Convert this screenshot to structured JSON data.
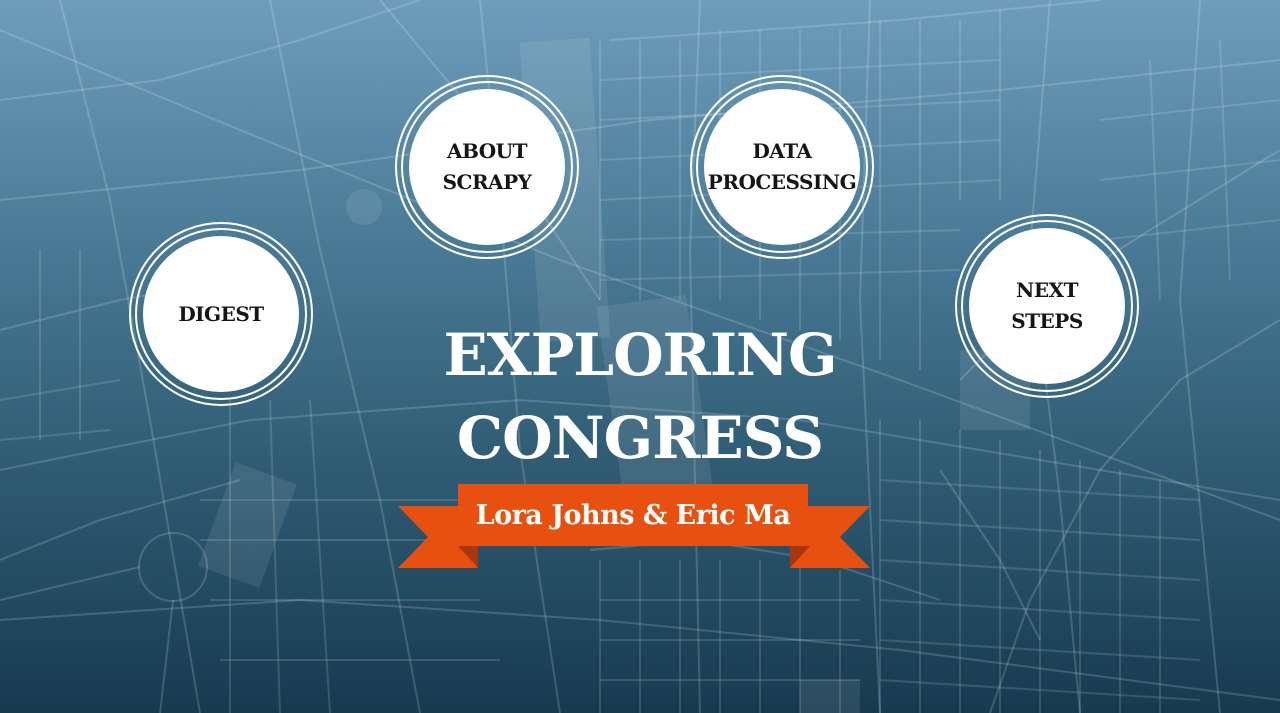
{
  "presentation": {
    "title_line_1": "EXPLORING",
    "title_line_2": "CONGRESS",
    "authors": "Lora Johns & Eric Ma"
  },
  "nav_circles": [
    {
      "label": "DIGEST"
    },
    {
      "label": "ABOUT\nSCRAPY"
    },
    {
      "label": "DATA\nPROCESSING"
    },
    {
      "label": "NEXT\nSTEPS"
    }
  ],
  "colors": {
    "background_top": "#6e9dbb",
    "background_bottom": "#173a4f",
    "ribbon": "#e8500f",
    "ribbon_shadow": "#a8380c",
    "circle_fill": "#ffffff",
    "title_text": "#ffffff"
  }
}
